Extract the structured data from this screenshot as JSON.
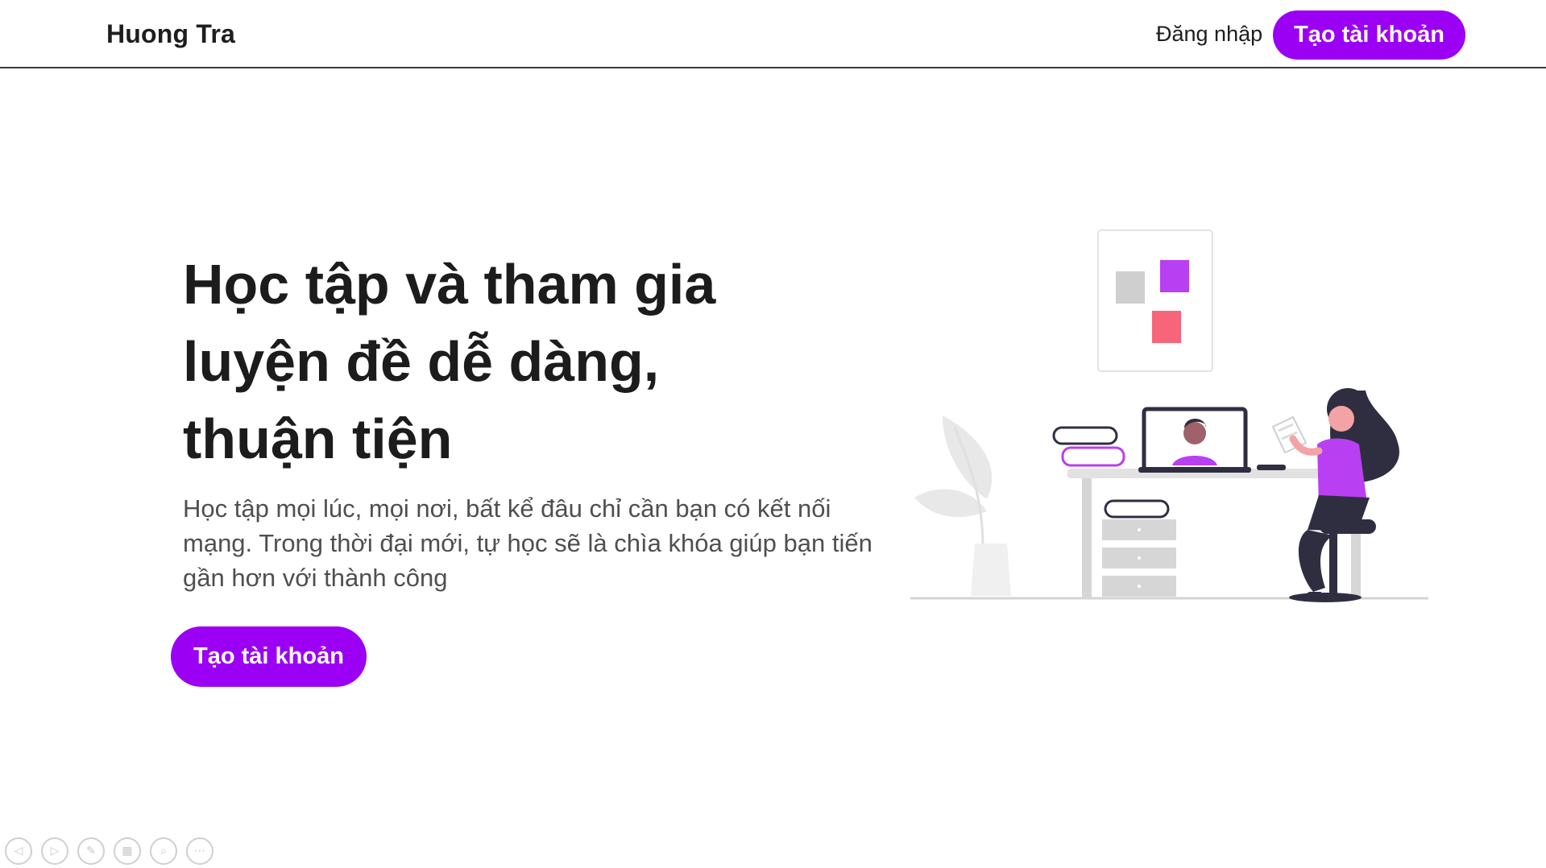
{
  "header": {
    "brand": "Huong Tra",
    "login_label": "Đăng nhập",
    "signup_label": "Tạo tài khoản"
  },
  "hero": {
    "title": "Học tập và tham gia luyện đề dễ dàng, thuận tiện",
    "subtitle": "Học tập mọi lúc, mọi nơi, bất kể đâu chỉ cần bạn có kết nối mạng. Trong thời đại mới, tự học sẽ là chìa khóa giúp bạn tiến gần hơn với thành công",
    "cta_label": "Tạo tài khoản"
  },
  "illustration": {
    "icon": "online-learning-illustration"
  },
  "viewer_controls": [
    "previous-icon",
    "next-icon",
    "pen-icon",
    "slides-grid-icon",
    "zoom-icon",
    "more-icon"
  ],
  "colors": {
    "accent": "#9b00f5",
    "accent_light": "#b83ff2",
    "pink": "#f6657a",
    "dark": "#2f2e41",
    "gray": "#cfcfcf"
  }
}
